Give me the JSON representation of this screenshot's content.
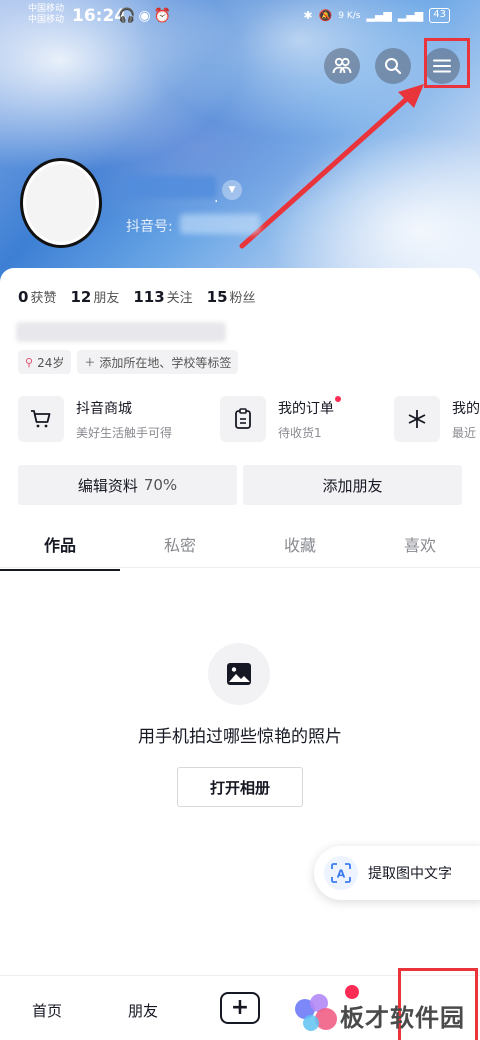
{
  "status_bar": {
    "carrier1": "中国移动",
    "carrier2": "中国移动",
    "time": "16:24",
    "speed": "9 K/s",
    "battery": "43"
  },
  "profile": {
    "douyin_id_label": "抖音号:",
    "stats": [
      {
        "count": "0",
        "label": "获赞"
      },
      {
        "count": "12",
        "label": "朋友"
      },
      {
        "count": "113",
        "label": "关注"
      },
      {
        "count": "15",
        "label": "粉丝"
      }
    ],
    "tags": [
      "24岁",
      "添加所在地、学校等标签"
    ]
  },
  "services": [
    {
      "title": "抖音商城",
      "subtitle": "美好生活触手可得",
      "icon": "cart-icon"
    },
    {
      "title": "我的订单",
      "subtitle": "待收货1",
      "icon": "order-icon"
    },
    {
      "title": "我的",
      "subtitle": "最近",
      "icon": "sparkle-icon"
    }
  ],
  "actions": {
    "edit_profile": "编辑资料",
    "edit_progress": "70%",
    "add_friend": "添加朋友"
  },
  "tabs": [
    "作品",
    "私密",
    "收藏",
    "喜欢"
  ],
  "empty_state": {
    "message": "用手机拍过哪些惊艳的照片",
    "button": "打开相册"
  },
  "ocr_button": "提取图中文字",
  "bottom_nav": [
    "首页",
    "朋友"
  ],
  "watermark": "板才软件园",
  "colors": {
    "accent_red": "#fe2c55",
    "highlight_red": "#e8343a",
    "text_primary": "#161823",
    "text_secondary": "#8a8b91"
  }
}
